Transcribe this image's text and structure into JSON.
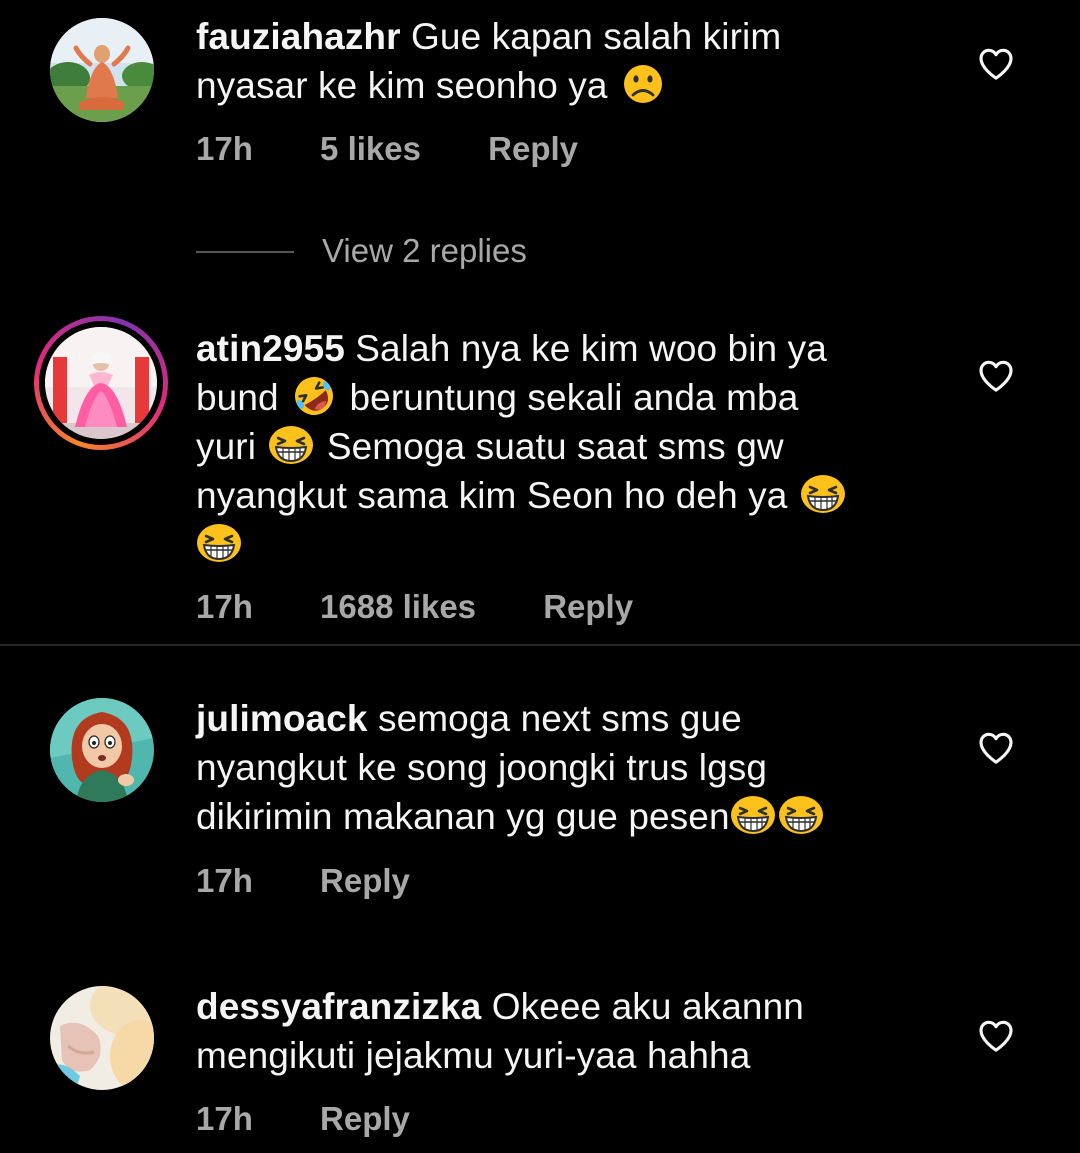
{
  "comments": [
    {
      "username": "fauziahazhr",
      "text_line1": "Gue kapan salah kirim",
      "text_line2": "nyasar ke kim seonho ya",
      "emoji": [
        "frowning-face"
      ],
      "time": "17h",
      "likes": "5 likes",
      "reply_label": "Reply",
      "view_replies": "View 2 replies"
    },
    {
      "username": "atin2955",
      "text_line1": "Salah nya ke kim woo bin ya",
      "text_line2a": "bund",
      "text_line2b": "beruntung sekali anda mba",
      "text_line3a": "yuri",
      "text_line3b": "Semoga suatu saat sms gw",
      "text_line4": "nyangkut sama kim Seon ho deh ya",
      "emoji": [
        "rolling-laughing-face",
        "grinning-squinting-face",
        "grinning-squinting-face",
        "grinning-squinting-face"
      ],
      "has_story_ring": true,
      "time": "17h",
      "likes": "1688 likes",
      "reply_label": "Reply"
    },
    {
      "username": "julimoack",
      "text_line1": "semoga next sms gue",
      "text_line2": "nyangkut ke song joongki trus lgsg",
      "text_line3": "dikirimin makanan yg gue pesen",
      "emoji": [
        "grinning-squinting-face",
        "grinning-squinting-face"
      ],
      "time": "17h",
      "reply_label": "Reply"
    },
    {
      "username": "dessyafranzizka",
      "text_line1": "Okeee aku akannn",
      "text_line2": "mengikuti jejakmu yuri-yaa hahha",
      "time": "17h",
      "reply_label": "Reply"
    }
  ],
  "icons": {
    "like": "heart-outline-icon"
  },
  "colors": {
    "background": "#000000",
    "primary_text": "#f5f5f5",
    "secondary_text": "#a8a8a8",
    "emoji_yellow": "#fcc21b",
    "story_ring_gradient": [
      "#f58529",
      "#dd2a7b",
      "#8134af"
    ]
  }
}
